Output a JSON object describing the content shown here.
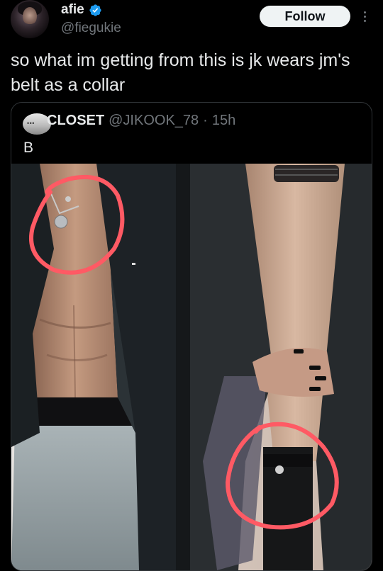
{
  "author": {
    "display_name": "afie",
    "handle": "@fiegukie",
    "verified": true
  },
  "actions": {
    "follow_label": "Follow",
    "more_icon": "more-vertical-icon"
  },
  "tweet": {
    "text": "so what im getting from this is jk wears jm's belt as a collar"
  },
  "quoted": {
    "name": "CLOSET",
    "handle": "@JIKOOK_78",
    "separator": "·",
    "time": "15h",
    "text": "B",
    "media": [
      {
        "description_icon": "photo-left",
        "annotation": "red-circle-necklace"
      },
      {
        "description_icon": "photo-right",
        "annotation": "red-circle-belt"
      }
    ]
  },
  "colors": {
    "background": "#000000",
    "text": "#e7e9ea",
    "muted": "#71767b",
    "verified": "#1d9bf0",
    "annotation": "#ff5a64"
  }
}
